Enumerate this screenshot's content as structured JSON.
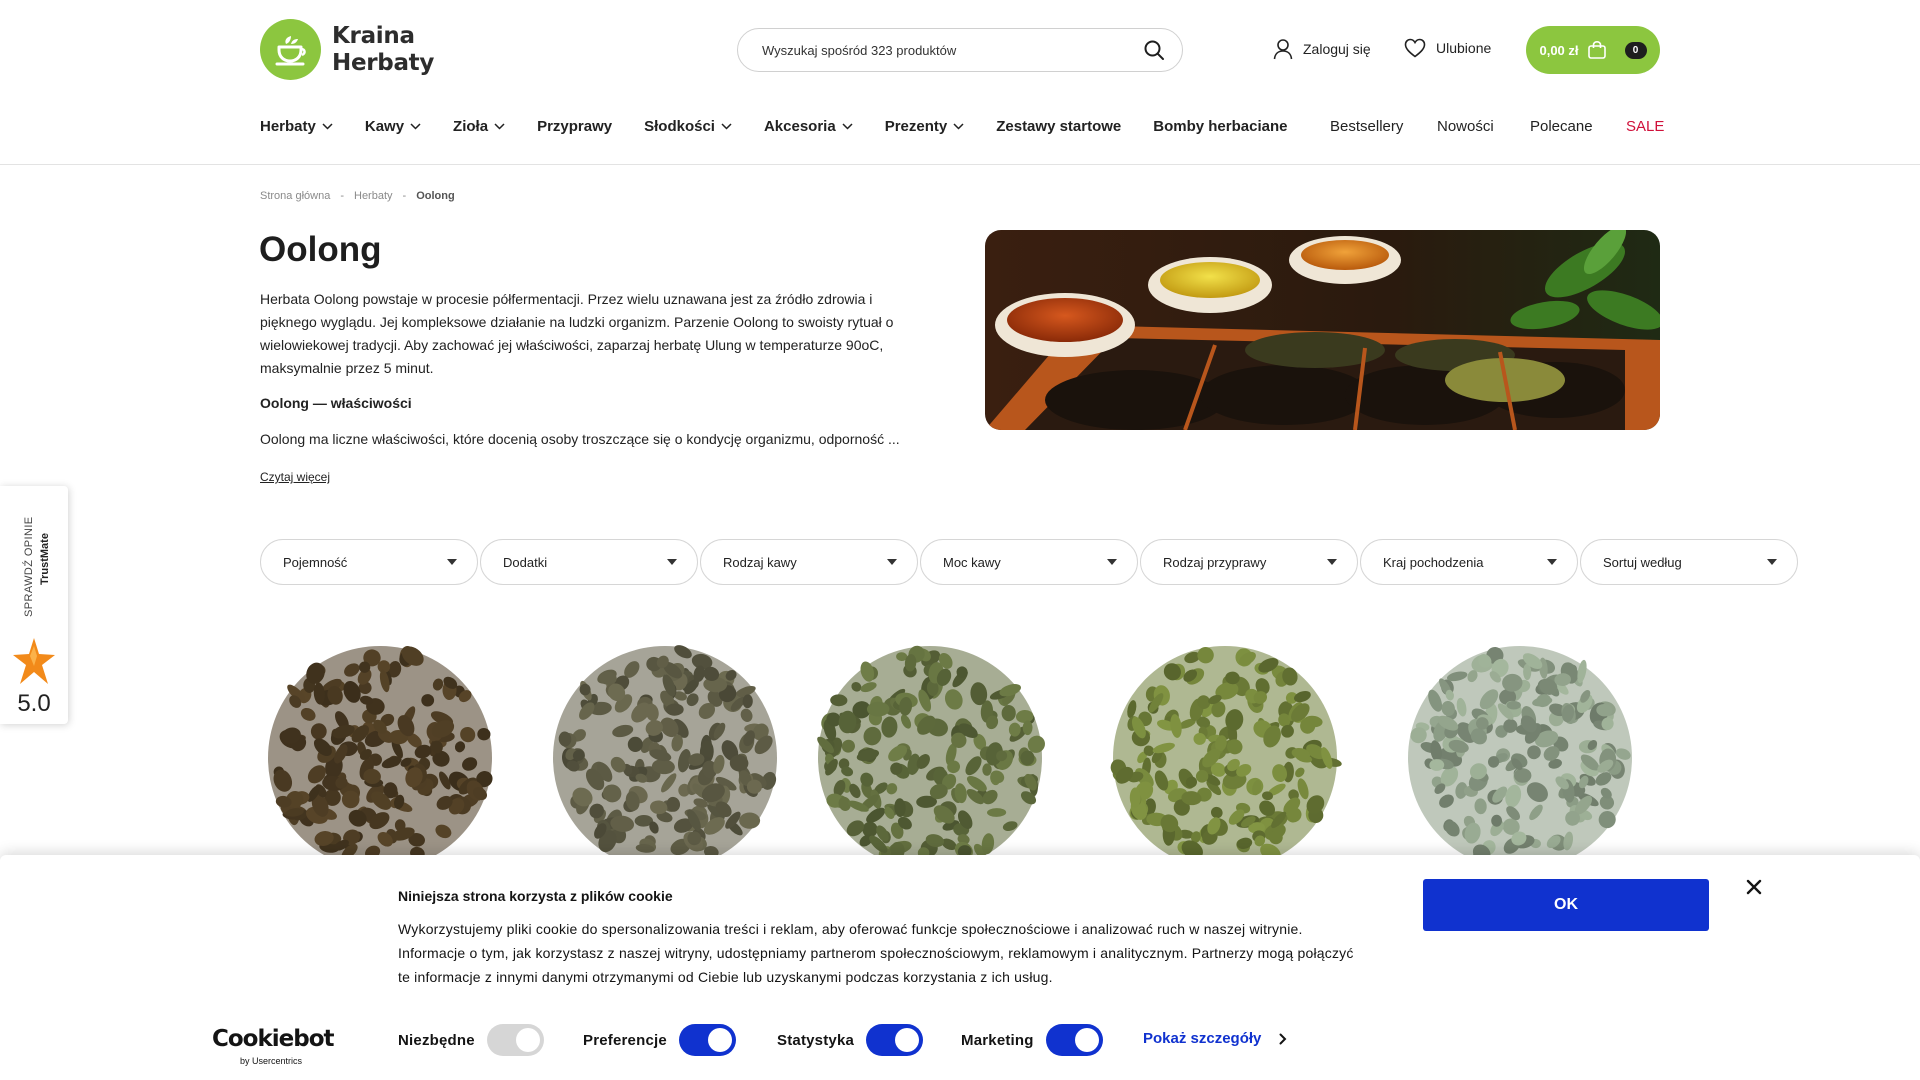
{
  "header": {
    "logo_line1": "Kraina",
    "logo_line2": "Herbaty",
    "search_placeholder": "Wyszukaj spośród 323 produktów",
    "login_label": "Zaloguj się",
    "favorites_label": "Ulubione",
    "cart_total": "0,00 zł",
    "cart_count": "0",
    "accent_color": "#8cc63f"
  },
  "nav": {
    "items": [
      {
        "label": "Herbaty",
        "dropdown": true
      },
      {
        "label": "Kawy",
        "dropdown": true
      },
      {
        "label": "Zioła",
        "dropdown": true
      },
      {
        "label": "Przyprawy",
        "dropdown": false
      },
      {
        "label": "Słodkości",
        "dropdown": true
      },
      {
        "label": "Akcesoria",
        "dropdown": true
      },
      {
        "label": "Prezenty",
        "dropdown": true
      },
      {
        "label": "Zestawy startowe",
        "dropdown": false
      },
      {
        "label": "Bomby herbaciane",
        "dropdown": false
      }
    ],
    "right_items": [
      "Bestsellery",
      "Nowości",
      "Polecane",
      "SALE"
    ],
    "sale_color": "#d0103a"
  },
  "breadcrumb": {
    "items": [
      "Strona główna",
      "Herbaty",
      "Oolong"
    ],
    "separator": "-"
  },
  "category": {
    "title": "Oolong",
    "intro": "Herbata Oolong powstaje w procesie półfermentacji. Przez wielu uznawana jest za źródło zdrowia i pięknego wyglądu. Jej kompleksowe działanie na ludzki organizm. Parzenie Oolong to swoisty rytuał o wielowiekowej tradycji. Aby zachować jej właściwości, zaparzaj herbatę Ulung w temperaturze 90oC, maksymalnie przez 5 minut.",
    "subheading": "Oolong — właściwości",
    "intro_2": "Oolong ma liczne właściwości, które docenią osoby troszczące się o kondycję organizmu, odporność ...",
    "read_more": "Czytaj więcej"
  },
  "filters": [
    "Pojemność",
    "Dodatki",
    "Rodzaj kawy",
    "Moc kawy",
    "Rodzaj przyprawy",
    "Kraj pochodzenia",
    "Sortuj według"
  ],
  "products": [
    {
      "tone": "#4a3a22"
    },
    {
      "tone": "#5c5a44"
    },
    {
      "tone": "#5e6a3c"
    },
    {
      "tone": "#6e7e38"
    },
    {
      "tone": "#8a9a84"
    }
  ],
  "trustmate": {
    "check_label": "SPRAWDŹ OPINIE",
    "brand": "TrustMate",
    "score": "5.0"
  },
  "cookie": {
    "title": "Niniejsza strona korzysta z plików cookie",
    "text": "Wykorzystujemy pliki cookie do spersonalizowania treści i reklam, aby oferować funkcje społecznościowe i analizować ruch w naszej witrynie. Informacje o tym, jak korzystasz z naszej witryny, udostępniamy partnerom społecznościowym, reklamowym i analitycznym. Partnerzy mogą połączyć te informacje z innymi danymi otrzymanymi od Ciebie lub uzyskanymi podczas korzystania z ich usług.",
    "ok_label": "OK",
    "brand": "Cookiebot",
    "brand_sub": "by Usercentrics",
    "toggles": [
      {
        "label": "Niezbędne",
        "state": "disabled"
      },
      {
        "label": "Preferencje",
        "state": "on"
      },
      {
        "label": "Statystyka",
        "state": "on"
      },
      {
        "label": "Marketing",
        "state": "on"
      }
    ],
    "details_label": "Pokaż szczegóły",
    "accent_color": "#1032cf"
  }
}
